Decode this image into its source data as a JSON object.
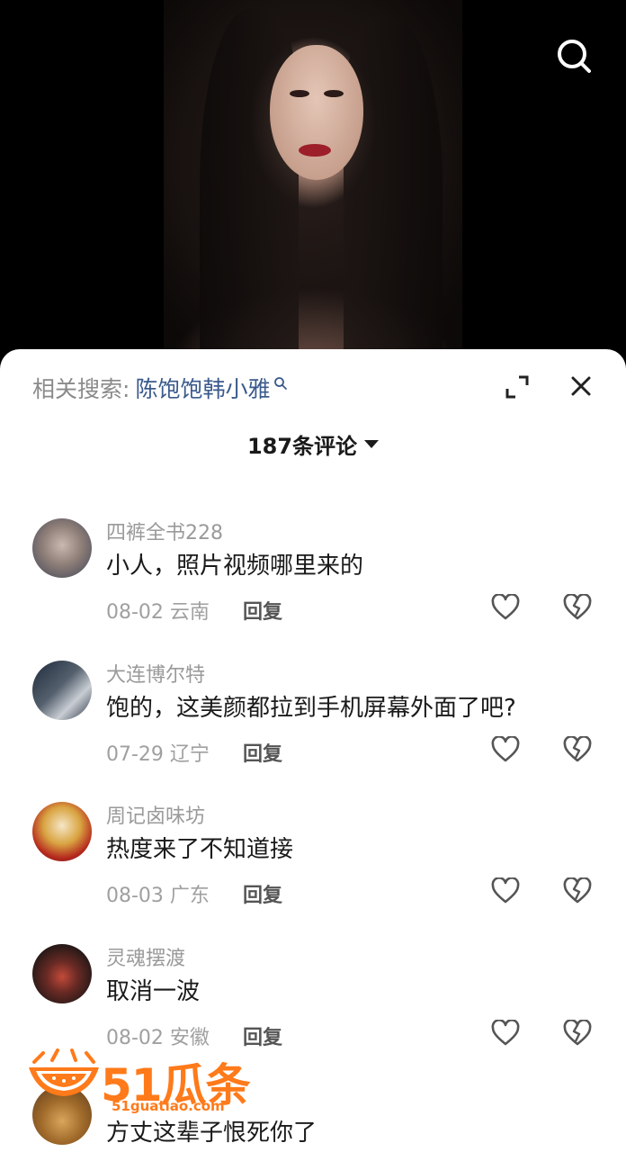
{
  "related_search": {
    "label": "相关搜索:",
    "keyword": "陈饱饱韩小雅"
  },
  "comments_header": {
    "count_label": "187条评论"
  },
  "comments": [
    {
      "user": "四裤全书228",
      "text": "小人，照片视频哪里来的",
      "meta": "08-02 云南",
      "reply": "回复"
    },
    {
      "user": "大连博尔特",
      "text": "饱的，这美颜都拉到手机屏幕外面了吧?",
      "meta": "07-29 辽宁",
      "reply": "回复"
    },
    {
      "user": "周记卤味坊",
      "text": "热度来了不知道接",
      "meta": "08-03 广东",
      "reply": "回复"
    },
    {
      "user": "灵魂摆渡",
      "text": "取消一波",
      "meta": "08-02 安徽",
      "reply": "回复"
    },
    {
      "user": "",
      "text": "方丈这辈子恨死你了",
      "meta": "",
      "reply": ""
    }
  ],
  "watermark": {
    "brand": "51瓜条",
    "site": "51guatiao.com"
  },
  "colors": {
    "keyword": "#3a5a8c",
    "watermark": "#ff7a1a"
  },
  "icons": [
    "search-icon",
    "expand-icon",
    "close-icon",
    "heart-icon",
    "broken-heart-icon",
    "watermelon-logo"
  ]
}
